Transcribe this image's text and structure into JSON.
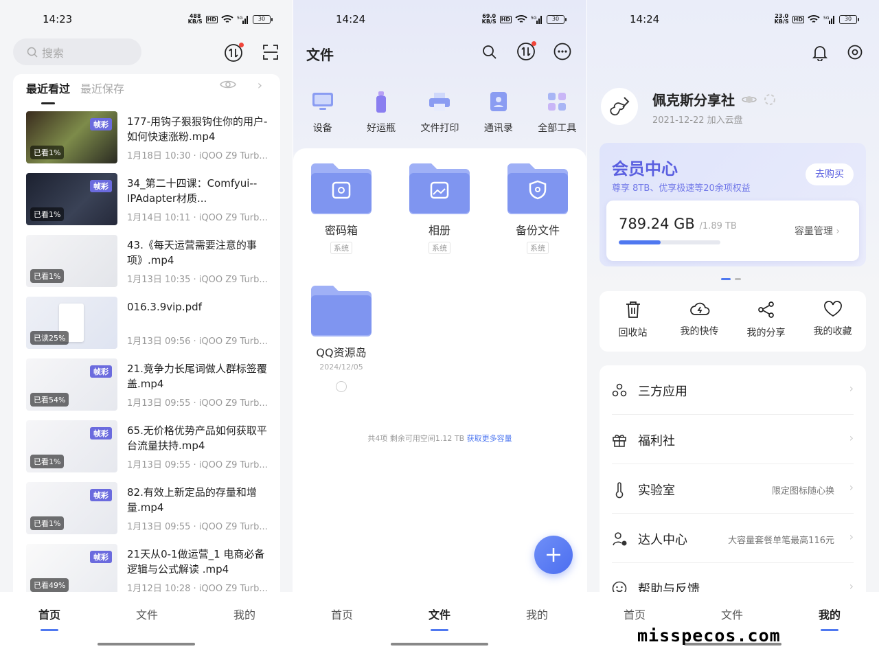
{
  "panel1": {
    "status": {
      "time": "14:23",
      "netspeed": "488",
      "netunit": "KB/S",
      "battery": "30"
    },
    "search_placeholder": "搜索",
    "tabs": [
      "最近看过",
      "最近保存"
    ],
    "items": [
      {
        "title": "177-用钩子狠狠钩住你的用户-如何快速涨粉.mp4",
        "meta": "1月18日 10:30 · iQOO Z9 Turb...",
        "badge": "帧彩",
        "progress": "已看1%"
      },
      {
        "title": "34_第二十四课：Comfyui--IPAdapter材质...",
        "meta": "1月14日 10:11 · iQOO Z9 Turb...",
        "badge": "帧彩",
        "progress": "已看1%"
      },
      {
        "title": "43.《每天运营需要注意的事项》.mp4",
        "meta": "1月13日 10:35 · iQOO Z9 Turb...",
        "badge": "",
        "progress": "已看1%"
      },
      {
        "title": "016.3.9vip.pdf",
        "meta": "1月13日 09:56 · iQOO Z9 Turb...",
        "badge": "",
        "progress": "已读25%"
      },
      {
        "title": "21.竞争力长尾词做人群标签覆盖.mp4",
        "meta": "1月13日 09:55 · iQOO Z9 Turb...",
        "badge": "帧彩",
        "progress": "已看54%"
      },
      {
        "title": "65.无价格优势产品如何获取平台流量扶持.mp4",
        "meta": "1月13日 09:55 · iQOO Z9 Turb...",
        "badge": "帧彩",
        "progress": "已看1%"
      },
      {
        "title": "82.有效上新定品的存量和增量.mp4",
        "meta": "1月13日 09:55 · iQOO Z9 Turb...",
        "badge": "帧彩",
        "progress": "已看1%"
      },
      {
        "title": "21天从0-1做运营_1 电商必备逻辑与公式解读 .mp4",
        "meta": "1月12日 10:28 · iQOO Z9 Turb...",
        "badge": "帧彩",
        "progress": "已看49%"
      }
    ]
  },
  "panel2": {
    "status": {
      "time": "14:24",
      "netspeed": "69.0",
      "netunit": "KB/S",
      "battery": "30"
    },
    "title": "文件",
    "tools": [
      "设备",
      "好运瓶",
      "文件打印",
      "通讯录",
      "全部工具"
    ],
    "folders": [
      {
        "name": "密码箱",
        "tag": "系统"
      },
      {
        "name": "相册",
        "tag": "系统"
      },
      {
        "name": "备份文件",
        "tag": "系统"
      }
    ],
    "qq_folder": {
      "name": "QQ资源岛",
      "date": "2024/12/05"
    },
    "footer_text": "共4项 剩余可用空间1.12 TB",
    "footer_link": "获取更多容量"
  },
  "panel3": {
    "status": {
      "time": "14:24",
      "netspeed": "23.0",
      "netunit": "KB/S",
      "battery": "30"
    },
    "username": "佩克斯分享社",
    "join_date": "2021-12-22 加入云盘",
    "vip_title": "会员中心",
    "vip_sub": "尊享 8TB、优享极速等20余项权益",
    "buy_label": "去购买",
    "used": "789.24 GB",
    "total": "/1.89 TB",
    "usage_fraction": 0.41,
    "capacity_label": "容量管理",
    "quick": [
      "回收站",
      "我的快传",
      "我的分享",
      "我的收藏"
    ],
    "menu": [
      {
        "label": "三方应用",
        "right": ""
      },
      {
        "label": "福利社",
        "right": ""
      },
      {
        "label": "实验室",
        "right": "限定图标随心换"
      },
      {
        "label": "达人中心",
        "right": "大容量套餐单笔最高116元"
      },
      {
        "label": "帮助与反馈",
        "right": ""
      }
    ]
  },
  "nav": [
    "首页",
    "文件",
    "我的"
  ],
  "watermark": "misspecos.com",
  "colors": {
    "accent": "#4f78f0",
    "vip": "#5a5fe0",
    "badge": "#6b6bde",
    "notify": "#f0453a"
  }
}
